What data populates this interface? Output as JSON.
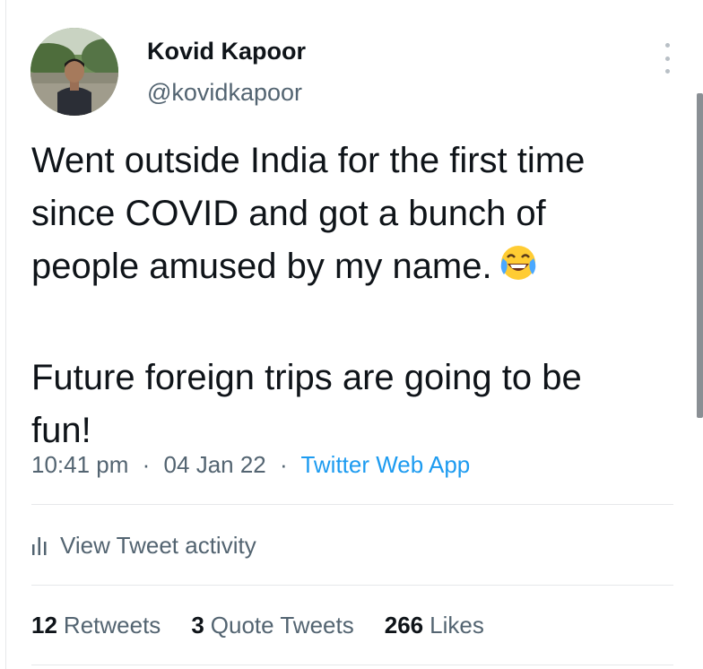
{
  "author": {
    "display_name": "Kovid Kapoor",
    "handle": "@kovidkapoor",
    "avatar_icon": "profile-photo"
  },
  "tweet": {
    "line1": "Went outside India for the first time",
    "line2": "since COVID and got a bunch of",
    "line3": "people amused by my name.",
    "emoji": "😂",
    "line4": "Future foreign trips are going to be",
    "line5": "fun!"
  },
  "meta": {
    "time": "10:41 pm",
    "date": "04 Jan 22",
    "separator": "·",
    "source": "Twitter Web App"
  },
  "activity": {
    "label": "View Tweet activity",
    "icon": "analytics-bar-icon"
  },
  "stats": {
    "retweets_count": "12",
    "retweets_label": "Retweets",
    "quotes_count": "3",
    "quotes_label": "Quote Tweets",
    "likes_count": "266",
    "likes_label": "Likes"
  },
  "colors": {
    "text_primary": "#0f1419",
    "text_secondary": "#536471",
    "link": "#1d9bf0",
    "divider": "#e6e8ea"
  }
}
